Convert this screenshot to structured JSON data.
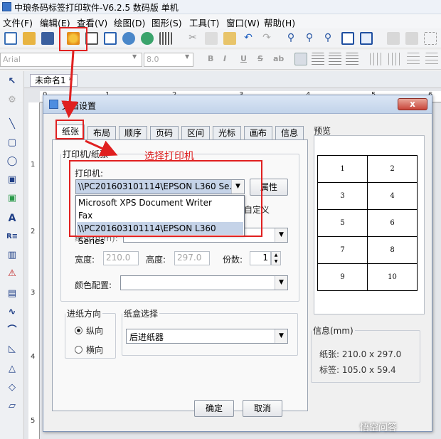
{
  "titlebar": {
    "title": "中琅条码标签打印软件-V6.2.5 数码版 单机"
  },
  "menu": [
    "文件(F)",
    "编辑(E)",
    "查看(V)",
    "绘图(D)",
    "图形(S)",
    "工具(T)",
    "窗口(W)",
    "帮助(H)"
  ],
  "font_toolbar": {
    "font_name": "Arial",
    "font_size": "8.0"
  },
  "document_tab": {
    "label": "未命名1 *"
  },
  "ruler": {
    "top": [
      "0",
      "1",
      "2",
      "3",
      "4",
      "5",
      "6"
    ],
    "left": [
      "1",
      "2",
      "3",
      "4",
      "5"
    ]
  },
  "dialog": {
    "title": "文档设置",
    "close_label": "x",
    "tabs": [
      "纸张",
      "布局",
      "顺序",
      "页码",
      "区间",
      "光标",
      "画布",
      "信息"
    ],
    "printer_group_legend": "打印机/纸张",
    "annotation": "选择打印机",
    "printer_label": "打印机:",
    "printer_value": "\\\\PC201603101114\\EPSON L360 Se...",
    "properties_button": "属性",
    "printer_options": [
      "Microsoft XPS Document Writer",
      "Fax",
      "\\\\PC201603101114\\EPSON L360 Series"
    ],
    "custom_label": "自定义",
    "paper_label": "纸张(mm):",
    "width_label": "宽度:",
    "width_value": "210.0",
    "height_label": "高度:",
    "height_value": "297.0",
    "copies_label": "份数:",
    "copies_value": "1",
    "color_label": "颜色配置:",
    "direction_legend": "进纸方向",
    "portrait": "纵向",
    "landscape": "横向",
    "tray_legend": "纸盒选择",
    "tray_value": "后进纸器",
    "preview_label": "预览",
    "preview_cells": [
      "1",
      "2",
      "3",
      "4",
      "5",
      "6",
      "7",
      "8",
      "9",
      "10"
    ],
    "info_legend": "信息(mm)",
    "paper_info": "纸张: 210.0 x 297.0",
    "label_info": "标签: 105.0 x 59.4",
    "ok_button": "确定",
    "cancel_button": "取消"
  },
  "watermark": "悟空问答",
  "colors": {
    "annotation_red": "#e02020",
    "selection": "#c5d3e8"
  }
}
